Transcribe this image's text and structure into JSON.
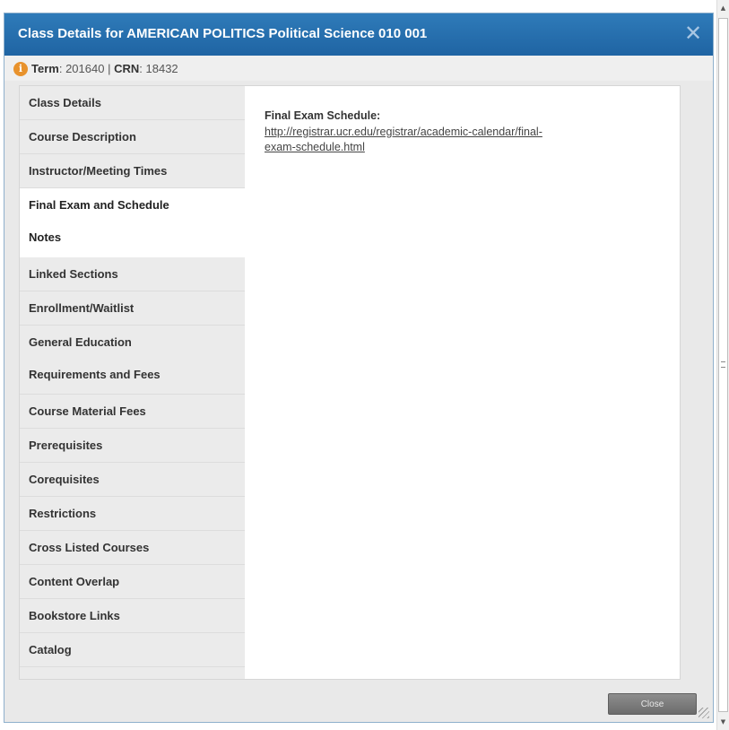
{
  "dialog": {
    "title": "Class Details for AMERICAN POLITICS Political Science 010 001",
    "close_glyph": "✕"
  },
  "info": {
    "term_label": "Term",
    "term_value": "201640",
    "separator": "|",
    "crn_label": "CRN",
    "crn_value": "18432"
  },
  "tabs": [
    {
      "label": "Class Details"
    },
    {
      "label": "Course Description"
    },
    {
      "label": "Instructor/Meeting Times"
    },
    {
      "label": "Final Exam and Schedule",
      "label2": "Notes",
      "active": true
    },
    {
      "label": "Linked Sections"
    },
    {
      "label": "Enrollment/Waitlist"
    },
    {
      "label": "General Education",
      "label2": "Requirements and Fees"
    },
    {
      "label": "Course Material Fees"
    },
    {
      "label": "Prerequisites"
    },
    {
      "label": "Corequisites"
    },
    {
      "label": "Restrictions"
    },
    {
      "label": "Cross Listed Courses"
    },
    {
      "label": "Content Overlap"
    },
    {
      "label": "Bookstore Links"
    },
    {
      "label": "Catalog"
    }
  ],
  "detail": {
    "heading": "Final Exam Schedule:",
    "link_line1": "http://registrar.ucr.edu/registrar/academic-calendar/final-",
    "link_line2": "exam-schedule.html"
  },
  "footer": {
    "close_label": "Close"
  },
  "colors": {
    "titlebar": "#1f64a3",
    "info_icon": "#e8922c"
  },
  "icons": {
    "info": "info-icon",
    "close": "close-icon",
    "resize": "resize-grip-icon"
  }
}
